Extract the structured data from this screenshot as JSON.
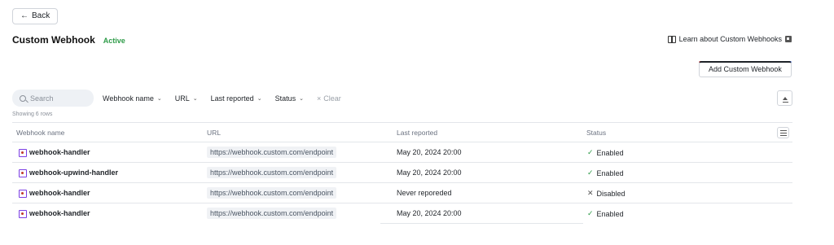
{
  "back": {
    "icon": "arrow-left-icon",
    "label": "Back"
  },
  "header": {
    "title": "Custom Webhook",
    "status": "Active",
    "learn_link": "Learn about Custom Webhooks"
  },
  "actions": {
    "add_label": "Add Custom Webhook"
  },
  "filters": {
    "search_placeholder": "Search",
    "items": [
      {
        "label": "Webhook name",
        "icon": "chevron-down-icon"
      },
      {
        "label": "URL",
        "icon": "chevron-down-icon"
      },
      {
        "label": "Last reported",
        "icon": "chevron-down-icon"
      },
      {
        "label": "Status",
        "icon": "chevron-down-icon"
      }
    ],
    "clear_label": "Clear"
  },
  "table": {
    "row_count_text": "Showing 6 rows",
    "columns": [
      "Webhook name",
      "URL",
      "Last reported",
      "Status"
    ],
    "rows": [
      {
        "name": "webhook-handler",
        "url": "https://webhook.custom.com/endpoint",
        "last_reported": "May 20, 2024 20:00",
        "status": "Enabled",
        "status_icon": "check"
      },
      {
        "name": "webhook-upwind-handler",
        "url": "https://webhook.custom.com/endpoint",
        "last_reported": "May 20, 2024 20:00",
        "status": "Enabled",
        "status_icon": "check"
      },
      {
        "name": "webhook-handler",
        "url": "https://webhook.custom.com/endpoint",
        "last_reported": "Never reporeded",
        "status": "Disabled",
        "status_icon": "x"
      },
      {
        "name": "webhook-handler",
        "url": "https://webhook.custom.com/endpoint",
        "last_reported": "May 20, 2024 20:00",
        "status": "Enabled",
        "status_icon": "check"
      }
    ]
  },
  "colors": {
    "active": "#2e9b48",
    "webhook_icon": "#7b3fe4",
    "accent_gradient": [
      "#e3363b",
      "#7a4be0",
      "#2a55d6"
    ]
  }
}
